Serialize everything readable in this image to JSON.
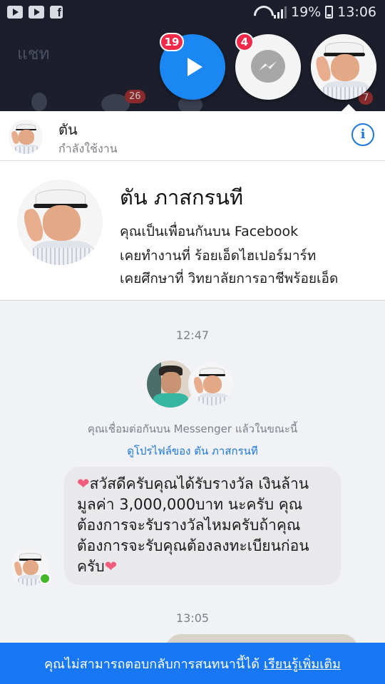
{
  "status_bar": {
    "battery": "19%",
    "time": "13:06",
    "icons": [
      "youtube-icon",
      "youtube-icon",
      "facebook-icon",
      "wifi-icon",
      "signal-icon",
      "battery-icon"
    ]
  },
  "background_app": {
    "title": "แชท",
    "badges": [
      "26",
      "7"
    ]
  },
  "chat_heads": [
    {
      "type": "video",
      "badge": "19",
      "icon": "play-icon",
      "color": "#1a87f2"
    },
    {
      "type": "messenger",
      "badge": "4",
      "icon": "messenger-icon"
    },
    {
      "type": "contact-avatar"
    }
  ],
  "header": {
    "name": "ตัน",
    "status": "กำลังใช้งาน",
    "info_icon": "info-icon",
    "accent": "#1a78e0"
  },
  "profile": {
    "full_name": "ตัน ภาสกรนที",
    "friend_line": "คุณเป็นเพื่อนกันบน Facebook",
    "work_line": "เคยทำงานที่ ร้อยเอ็ดไฮเปอร์มาร์ท",
    "study_line": "เคยศึกษาที่ วิทยาลัยการอาชีพร้อยเอ็ด"
  },
  "conversation": {
    "time_1": "12:47",
    "connected_text": "คุณเชื่อมต่อกันบน Messenger แล้วในขณะนี้",
    "view_profile_link": "ดูโปรไฟล์ของ ตัน ภาสกรนที",
    "message": {
      "heart_start": "❤",
      "line_1": "สวัสดีครับคุณได้รับรางวัล เงินล้าน",
      "line_2": "มูลค่า 3,000,000บาท นะครับ คุณ",
      "line_3": "ต้องการจะรับรางวัลไหมครับถ้าคุณ",
      "line_4": "ต้องการจะรับคุณต้องลงทะเบียนก่อน",
      "line_5": "ครับ",
      "heart_end": "❤"
    },
    "time_2": "13:05"
  },
  "footer": {
    "text": "คุณไม่สามารถตอบกลับการสนทนานี้ได้",
    "link": "เรียนรู้เพิ่มเติม",
    "color": "#1877f2"
  }
}
